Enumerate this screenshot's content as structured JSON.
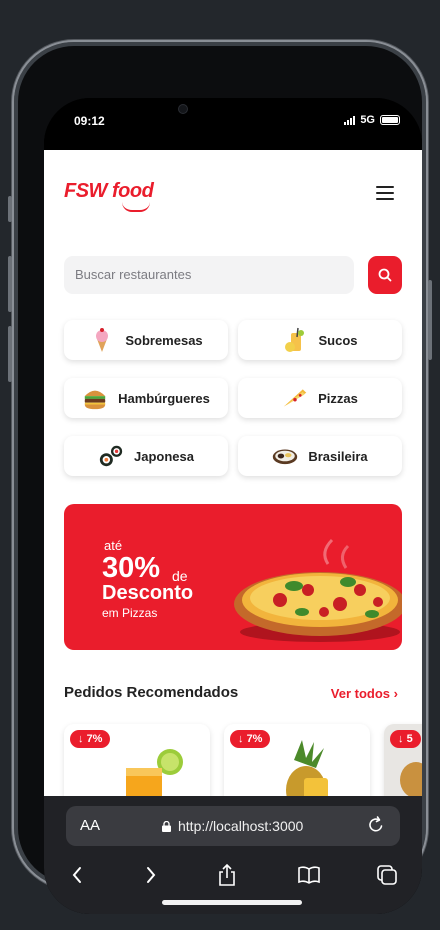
{
  "status": {
    "time": "09:12",
    "network": "5G"
  },
  "app": {
    "logo_text": "FSW food",
    "search": {
      "placeholder": "Buscar restaurantes"
    },
    "categories": [
      {
        "label": "Sobremesas",
        "icon": "ice-cream-icon"
      },
      {
        "label": "Sucos",
        "icon": "juice-icon"
      },
      {
        "label": "Hambúrgueres",
        "icon": "burger-icon"
      },
      {
        "label": "Pizzas",
        "icon": "pizza-slice-icon"
      },
      {
        "label": "Japonesa",
        "icon": "sushi-icon"
      },
      {
        "label": "Brasileira",
        "icon": "feijoada-icon"
      }
    ],
    "banner": {
      "line1": "até",
      "percent": "30%",
      "de": "de",
      "line2": "Desconto",
      "line3": "em Pizzas"
    },
    "recommended": {
      "title": "Pedidos Recomendados",
      "see_all": "Ver todos",
      "cards": [
        {
          "discount": "7%"
        },
        {
          "discount": "7%"
        },
        {
          "discount": "5"
        }
      ]
    }
  },
  "browser": {
    "aa": "AA",
    "url": "http://localhost:3000"
  },
  "colors": {
    "brand": "#ea1d2c",
    "background": "#23272c",
    "browser_bar": "#212226"
  }
}
